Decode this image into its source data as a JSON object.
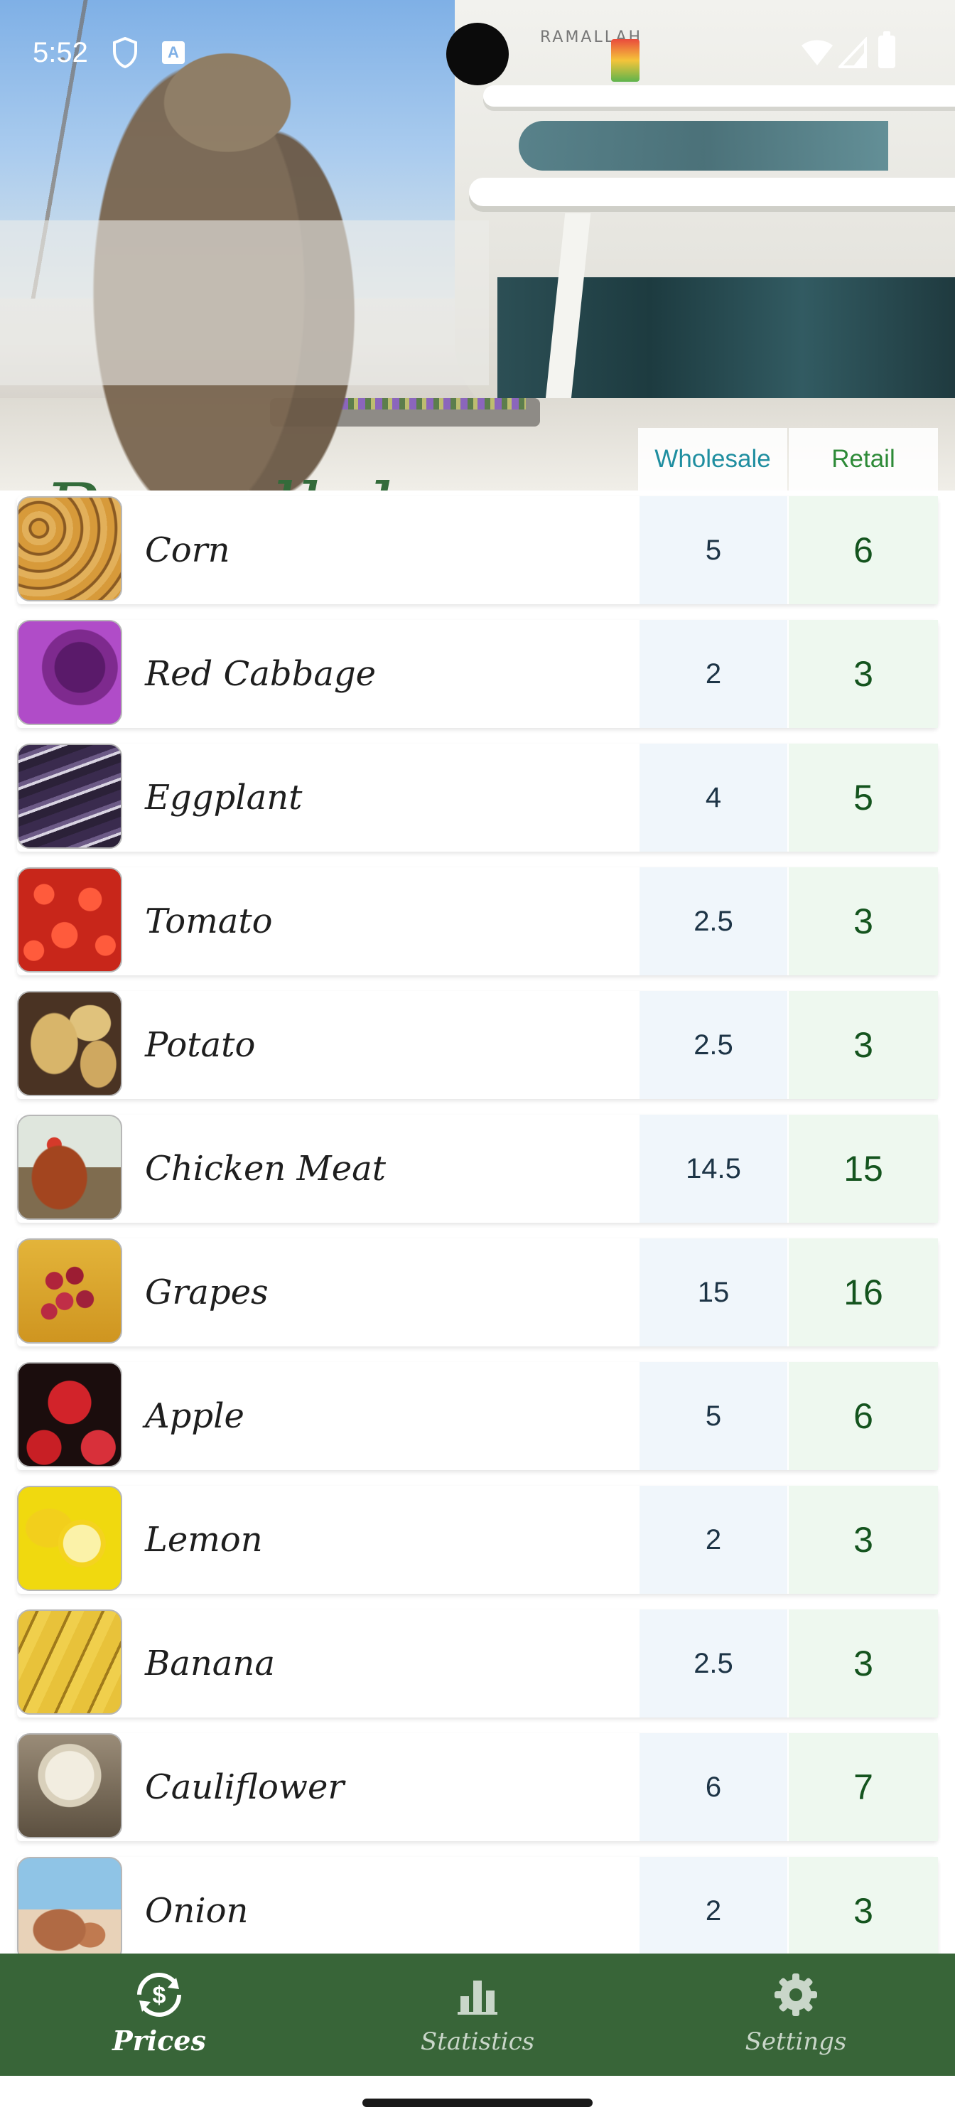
{
  "status_bar": {
    "time": "5:52",
    "a_badge": "A"
  },
  "header": {
    "city": "Ramallah",
    "building_sign": "RAMALLAH",
    "columns": {
      "wholesale": "Wholesale",
      "retail": "Retail"
    },
    "colors": {
      "title": "#336b3a",
      "wholesale_header": "#1f8ea0",
      "retail_header": "#2d8a37"
    }
  },
  "items": [
    {
      "name": "Corn",
      "wholesale": "5",
      "retail": "6",
      "image": "corn"
    },
    {
      "name": "Red Cabbage",
      "wholesale": "2",
      "retail": "3",
      "image": "cabbage"
    },
    {
      "name": "Eggplant",
      "wholesale": "4",
      "retail": "5",
      "image": "eggplant"
    },
    {
      "name": "Tomato",
      "wholesale": "2.5",
      "retail": "3",
      "image": "tomato"
    },
    {
      "name": "Potato",
      "wholesale": "2.5",
      "retail": "3",
      "image": "potato"
    },
    {
      "name": "Chicken Meat",
      "wholesale": "14.5",
      "retail": "15",
      "image": "chicken"
    },
    {
      "name": "Grapes",
      "wholesale": "15",
      "retail": "16",
      "image": "grapes"
    },
    {
      "name": "Apple",
      "wholesale": "5",
      "retail": "6",
      "image": "apple"
    },
    {
      "name": "Lemon",
      "wholesale": "2",
      "retail": "3",
      "image": "lemon"
    },
    {
      "name": "Banana",
      "wholesale": "2.5",
      "retail": "3",
      "image": "banana"
    },
    {
      "name": "Cauliflower",
      "wholesale": "6",
      "retail": "7",
      "image": "cauliflower"
    },
    {
      "name": "Onion",
      "wholesale": "2",
      "retail": "3",
      "image": "onion"
    }
  ],
  "bottom_nav": {
    "items": [
      {
        "label": "Prices",
        "icon": "dollar-exchange-icon",
        "active": true
      },
      {
        "label": "Statistics",
        "icon": "bar-chart-icon",
        "active": false
      },
      {
        "label": "Settings",
        "icon": "gear-icon",
        "active": false
      }
    ],
    "background": "#386538"
  }
}
